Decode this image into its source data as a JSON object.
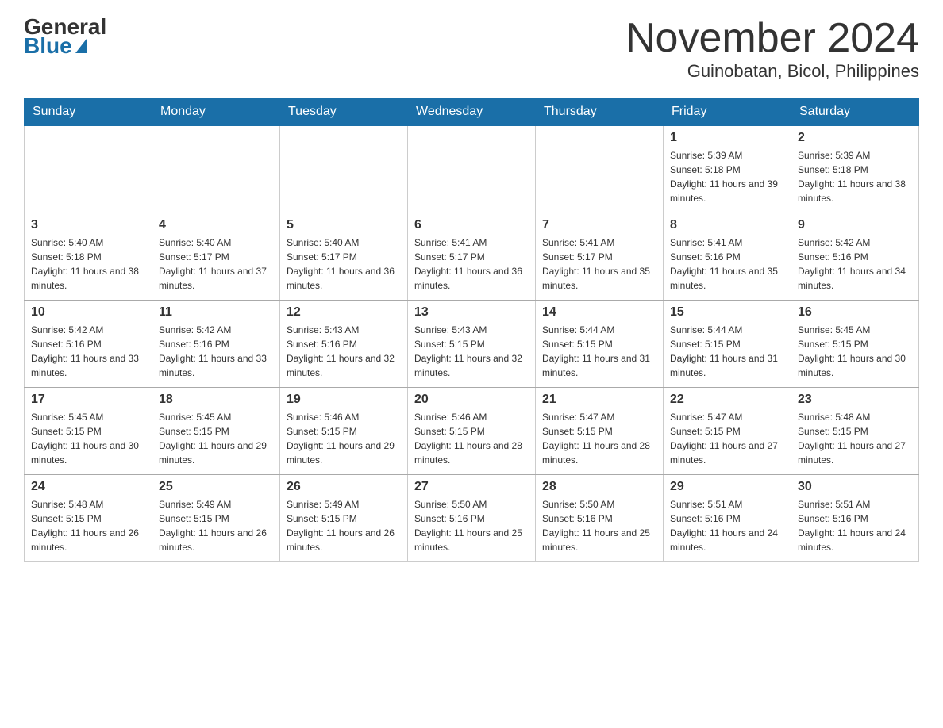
{
  "header": {
    "logo_general": "General",
    "logo_blue": "Blue",
    "month_title": "November 2024",
    "location": "Guinobatan, Bicol, Philippines"
  },
  "weekdays": [
    "Sunday",
    "Monday",
    "Tuesday",
    "Wednesday",
    "Thursday",
    "Friday",
    "Saturday"
  ],
  "weeks": [
    [
      {
        "day": "",
        "info": ""
      },
      {
        "day": "",
        "info": ""
      },
      {
        "day": "",
        "info": ""
      },
      {
        "day": "",
        "info": ""
      },
      {
        "day": "",
        "info": ""
      },
      {
        "day": "1",
        "info": "Sunrise: 5:39 AM\nSunset: 5:18 PM\nDaylight: 11 hours and 39 minutes."
      },
      {
        "day": "2",
        "info": "Sunrise: 5:39 AM\nSunset: 5:18 PM\nDaylight: 11 hours and 38 minutes."
      }
    ],
    [
      {
        "day": "3",
        "info": "Sunrise: 5:40 AM\nSunset: 5:18 PM\nDaylight: 11 hours and 38 minutes."
      },
      {
        "day": "4",
        "info": "Sunrise: 5:40 AM\nSunset: 5:17 PM\nDaylight: 11 hours and 37 minutes."
      },
      {
        "day": "5",
        "info": "Sunrise: 5:40 AM\nSunset: 5:17 PM\nDaylight: 11 hours and 36 minutes."
      },
      {
        "day": "6",
        "info": "Sunrise: 5:41 AM\nSunset: 5:17 PM\nDaylight: 11 hours and 36 minutes."
      },
      {
        "day": "7",
        "info": "Sunrise: 5:41 AM\nSunset: 5:17 PM\nDaylight: 11 hours and 35 minutes."
      },
      {
        "day": "8",
        "info": "Sunrise: 5:41 AM\nSunset: 5:16 PM\nDaylight: 11 hours and 35 minutes."
      },
      {
        "day": "9",
        "info": "Sunrise: 5:42 AM\nSunset: 5:16 PM\nDaylight: 11 hours and 34 minutes."
      }
    ],
    [
      {
        "day": "10",
        "info": "Sunrise: 5:42 AM\nSunset: 5:16 PM\nDaylight: 11 hours and 33 minutes."
      },
      {
        "day": "11",
        "info": "Sunrise: 5:42 AM\nSunset: 5:16 PM\nDaylight: 11 hours and 33 minutes."
      },
      {
        "day": "12",
        "info": "Sunrise: 5:43 AM\nSunset: 5:16 PM\nDaylight: 11 hours and 32 minutes."
      },
      {
        "day": "13",
        "info": "Sunrise: 5:43 AM\nSunset: 5:15 PM\nDaylight: 11 hours and 32 minutes."
      },
      {
        "day": "14",
        "info": "Sunrise: 5:44 AM\nSunset: 5:15 PM\nDaylight: 11 hours and 31 minutes."
      },
      {
        "day": "15",
        "info": "Sunrise: 5:44 AM\nSunset: 5:15 PM\nDaylight: 11 hours and 31 minutes."
      },
      {
        "day": "16",
        "info": "Sunrise: 5:45 AM\nSunset: 5:15 PM\nDaylight: 11 hours and 30 minutes."
      }
    ],
    [
      {
        "day": "17",
        "info": "Sunrise: 5:45 AM\nSunset: 5:15 PM\nDaylight: 11 hours and 30 minutes."
      },
      {
        "day": "18",
        "info": "Sunrise: 5:45 AM\nSunset: 5:15 PM\nDaylight: 11 hours and 29 minutes."
      },
      {
        "day": "19",
        "info": "Sunrise: 5:46 AM\nSunset: 5:15 PM\nDaylight: 11 hours and 29 minutes."
      },
      {
        "day": "20",
        "info": "Sunrise: 5:46 AM\nSunset: 5:15 PM\nDaylight: 11 hours and 28 minutes."
      },
      {
        "day": "21",
        "info": "Sunrise: 5:47 AM\nSunset: 5:15 PM\nDaylight: 11 hours and 28 minutes."
      },
      {
        "day": "22",
        "info": "Sunrise: 5:47 AM\nSunset: 5:15 PM\nDaylight: 11 hours and 27 minutes."
      },
      {
        "day": "23",
        "info": "Sunrise: 5:48 AM\nSunset: 5:15 PM\nDaylight: 11 hours and 27 minutes."
      }
    ],
    [
      {
        "day": "24",
        "info": "Sunrise: 5:48 AM\nSunset: 5:15 PM\nDaylight: 11 hours and 26 minutes."
      },
      {
        "day": "25",
        "info": "Sunrise: 5:49 AM\nSunset: 5:15 PM\nDaylight: 11 hours and 26 minutes."
      },
      {
        "day": "26",
        "info": "Sunrise: 5:49 AM\nSunset: 5:15 PM\nDaylight: 11 hours and 26 minutes."
      },
      {
        "day": "27",
        "info": "Sunrise: 5:50 AM\nSunset: 5:16 PM\nDaylight: 11 hours and 25 minutes."
      },
      {
        "day": "28",
        "info": "Sunrise: 5:50 AM\nSunset: 5:16 PM\nDaylight: 11 hours and 25 minutes."
      },
      {
        "day": "29",
        "info": "Sunrise: 5:51 AM\nSunset: 5:16 PM\nDaylight: 11 hours and 24 minutes."
      },
      {
        "day": "30",
        "info": "Sunrise: 5:51 AM\nSunset: 5:16 PM\nDaylight: 11 hours and 24 minutes."
      }
    ]
  ]
}
